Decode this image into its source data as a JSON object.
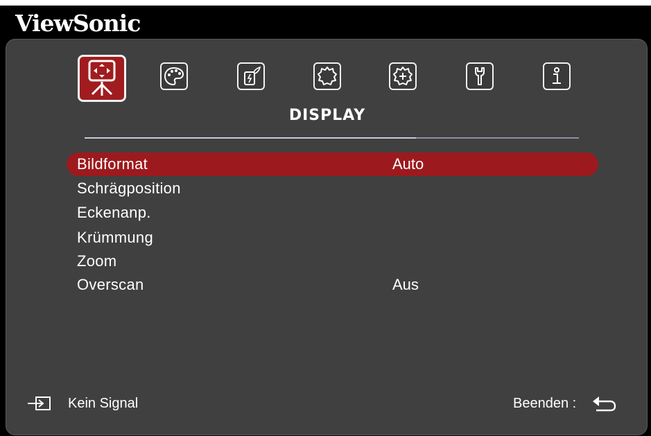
{
  "brand": "ViewSonic",
  "tabs": [
    {
      "name": "display-icon",
      "active": true
    },
    {
      "name": "palette-icon",
      "active": false
    },
    {
      "name": "power-icon",
      "active": false
    },
    {
      "name": "gear-icon",
      "active": false
    },
    {
      "name": "advanced-gear-icon",
      "active": false
    },
    {
      "name": "wrench-icon",
      "active": false
    },
    {
      "name": "info-icon",
      "active": false
    }
  ],
  "section_title": "DISPLAY",
  "menu": [
    {
      "label": "Bildformat",
      "value": "Auto",
      "selected": true
    },
    {
      "label": "Schrägposition",
      "value": ""
    },
    {
      "label": "Eckenanp.",
      "value": ""
    },
    {
      "label": "Krümmung",
      "value": ""
    },
    {
      "label": "Zoom",
      "value": ""
    },
    {
      "label": "Overscan",
      "value": "Aus"
    }
  ],
  "status": {
    "input_icon": "input-source-icon",
    "signal_text": "Kein Signal",
    "exit_label": "Beenden :",
    "exit_icon": "return-icon"
  },
  "colors": {
    "accent": "#9c1a1e",
    "panel": "#404040",
    "frame": "#000000",
    "text": "#ffffff"
  }
}
